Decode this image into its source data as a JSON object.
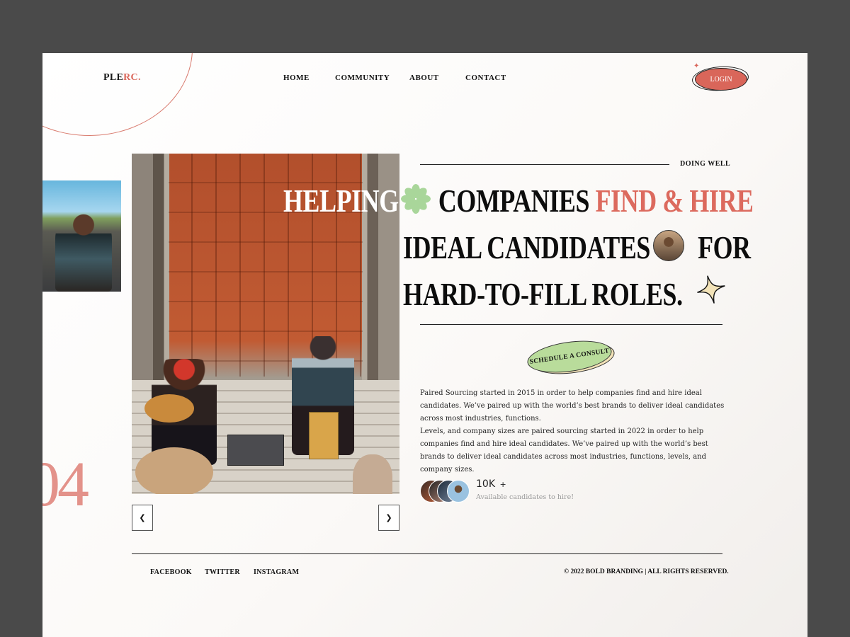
{
  "brand": {
    "logo_main": "PLE",
    "logo_accent": "RC.",
    "accent_color": "#d9665a"
  },
  "nav": {
    "items": [
      {
        "label": "HOME"
      },
      {
        "label": "COMMUNITY"
      },
      {
        "label": "ABOUT"
      },
      {
        "label": "CONTACT"
      }
    ],
    "login_label": "LOGIN"
  },
  "hero": {
    "tag": "DOING WELL",
    "line1_white": "HELPING",
    "line1_black": "COMPANIES",
    "line1_red": "FIND & HIRE",
    "line2_a": "IDEAL CANDIDATES",
    "line2_b": "FOR",
    "line3": "HARD-TO-FILL ROLES.",
    "cta_label": "SCHEDULE A CONSULT"
  },
  "gallery": {
    "counter": "04",
    "prev_icon": "chevron-left-icon",
    "next_icon": "chevron-right-icon"
  },
  "about": {
    "paragraph1": "Paired Sourcing started in 2015 in order to help companies find and hire ideal candidates. We’ve paired up with the world’s best brands to deliver ideal candidates across most industries, functions.",
    "paragraph2": "Levels, and company sizes are paired sourcing started in 2022 in order to help companies find and hire ideal candidates. We’ve paired up with the world’s best brands to deliver ideal candidates across most industries, functions, levels, and company sizes."
  },
  "stats": {
    "count": "10K",
    "suffix": "+",
    "label": "Available candidates to hire!"
  },
  "footer": {
    "links": [
      {
        "label": "FACEBOOK"
      },
      {
        "label": "TWITTER"
      },
      {
        "label": "INSTAGRAM"
      }
    ],
    "copyright": "© 2022 BOLD BRANDING | ALL RIGHTS RESERVED."
  },
  "colors": {
    "background_frame": "#4a4a4a",
    "coral": "#dc6a5e",
    "mint": "#b9dc9b",
    "cream": "#f3e3b8",
    "counter_pink": "#e3928a"
  }
}
